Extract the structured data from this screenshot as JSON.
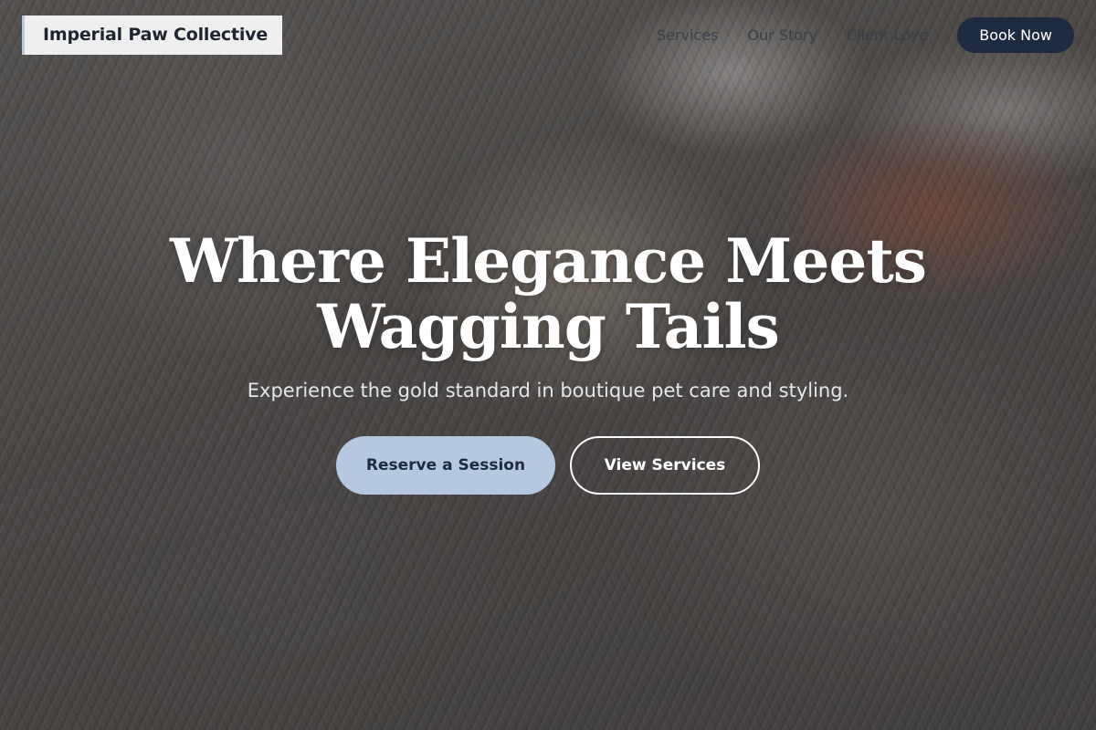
{
  "brand": {
    "name": "Imperial Paw Collective"
  },
  "nav": {
    "links": [
      "Services",
      "Our Story",
      "Client Love"
    ],
    "cta_label": "Book Now"
  },
  "hero": {
    "headline_line1": "Where Elegance Meets",
    "headline_line2": "Wagging Tails",
    "subheadline": "Experience the gold standard in boutique pet care and styling.",
    "primary_cta": "Reserve a Session",
    "secondary_cta": "View Services",
    "background_image": "tabby-cats-cuddling-photo"
  },
  "colors": {
    "accent": "#b6c8e0",
    "nav_cta_bg": "#1e2a3f",
    "logo_bg": "#efefef"
  }
}
